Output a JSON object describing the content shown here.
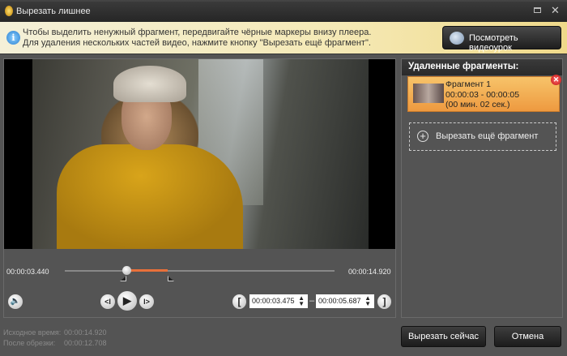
{
  "window": {
    "title": "Вырезать лишнее",
    "icons": [
      "app-icon",
      "maximize-icon",
      "close-icon"
    ]
  },
  "info": {
    "line1": "Чтобы выделить ненужный фрагмент, передвигайте чёрные маркеры внизу плеера.",
    "line2": "Для удаления нескольких частей видео, нажмите кнопку \"Вырезать ещё фрагмент\".",
    "tutorial_label": "Посмотреть видеоурок"
  },
  "player": {
    "current_time": "00:00:03.440",
    "total_time": "00:00:14.920",
    "start_value": "00:00:03.475",
    "end_value": "00:00:05.687",
    "dash": "–",
    "position_fraction": 0.23,
    "selection_start_fraction": 0.233,
    "selection_end_fraction": 0.381
  },
  "stats": {
    "original_label": "Исходное время:",
    "original_value": "00:00:14.920",
    "after_label": "После обрезки:",
    "after_value": "00:00:12.708"
  },
  "fragments": {
    "header": "Удаленные фрагменты:",
    "items": [
      {
        "name": "Фрагмент 1",
        "range": "00:00:03 - 00:00:05",
        "duration": "(00 мин. 02 сек.)"
      }
    ],
    "add_label": "Вырезать ещё фрагмент"
  },
  "actions": {
    "cut_now": "Вырезать сейчас",
    "cancel": "Отмена"
  },
  "colors": {
    "accent": "#e8703a",
    "fragment": "#f2a850",
    "info_bg": "#f5e9b5"
  }
}
